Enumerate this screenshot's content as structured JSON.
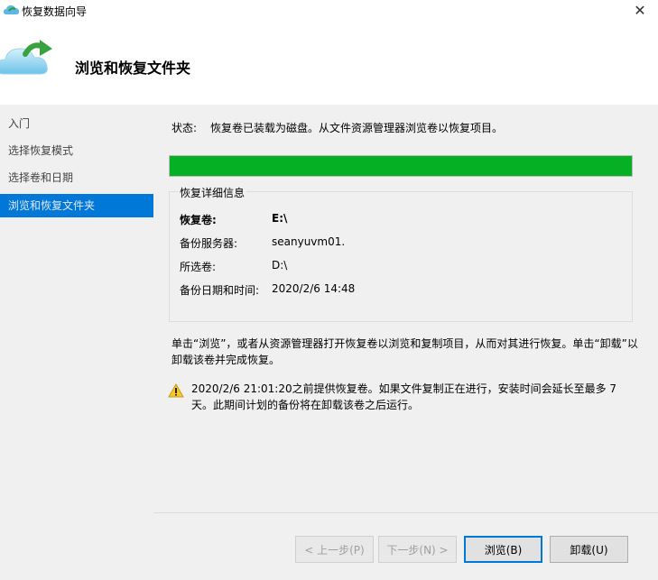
{
  "window": {
    "title": "恢复数据向导",
    "close_glyph": "✕"
  },
  "header": {
    "heading": "浏览和恢复文件夹"
  },
  "sidebar": {
    "items": [
      {
        "label": "入门"
      },
      {
        "label": "选择恢复模式"
      },
      {
        "label": "选择卷和日期"
      },
      {
        "label": "浏览和恢复文件夹",
        "active": true
      }
    ]
  },
  "status": {
    "label": "状态:",
    "text": "恢复卷已装载为磁盘。从文件资源管理器浏览卷以恢复项目。",
    "progress_percent": 100,
    "progress_color": "#06b025"
  },
  "details": {
    "legend": "恢复详细信息",
    "rows": [
      {
        "key": "恢复卷:",
        "value": "E:\\"
      },
      {
        "key": "备份服务器:",
        "value": "seanyuvm01."
      },
      {
        "key": "所选卷:",
        "value": "D:\\"
      },
      {
        "key": "备份日期和时间:",
        "value": "2020/2/6 14:48"
      }
    ]
  },
  "info": {
    "text": "单击“浏览”，或者从资源管理器打开恢复卷以浏览和复制项目，从而对其进行恢复。单击“卸载”以卸载该卷并完成恢复。"
  },
  "warning": {
    "icon": "warning-icon",
    "text": "2020/2/6 21:01:20之前提供恢复卷。如果文件复制正在进行，安装时间会延长至最多 7 天。此期间计划的备份将在卸载该卷之后运行。"
  },
  "buttons": {
    "back": "< 上一步(P)",
    "next": "下一步(N) >",
    "browse": "浏览(B)",
    "unmount": "卸载(U)"
  },
  "colors": {
    "accent": "#0078d7",
    "panel": "#f0f0f0"
  }
}
